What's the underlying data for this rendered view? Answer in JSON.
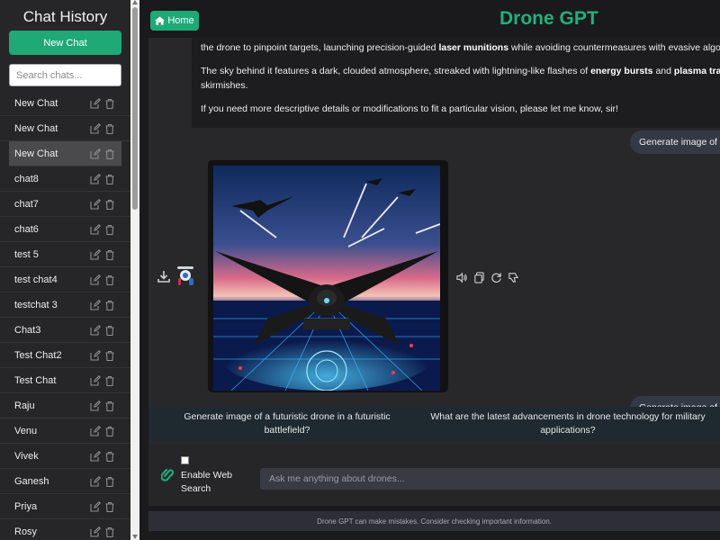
{
  "sidebar": {
    "title": "Chat History",
    "new_chat_label": "New Chat",
    "search_placeholder": "Search chats...",
    "items": [
      {
        "label": "New Chat",
        "active": false
      },
      {
        "label": "New Chat",
        "active": false
      },
      {
        "label": "New Chat",
        "active": true
      },
      {
        "label": "chat8",
        "active": false
      },
      {
        "label": "chat7",
        "active": false
      },
      {
        "label": "chat6",
        "active": false
      },
      {
        "label": "test 5",
        "active": false
      },
      {
        "label": "test chat4",
        "active": false
      },
      {
        "label": "testchat 3",
        "active": false
      },
      {
        "label": "Chat3",
        "active": false
      },
      {
        "label": "Test Chat2",
        "active": false
      },
      {
        "label": "Test Chat",
        "active": false
      },
      {
        "label": "Raju",
        "active": false
      },
      {
        "label": "Venu",
        "active": false
      },
      {
        "label": "Vivek",
        "active": false
      },
      {
        "label": "Ganesh",
        "active": false
      },
      {
        "label": "Priya",
        "active": false
      },
      {
        "label": "Rosy",
        "active": false
      }
    ]
  },
  "header": {
    "home_label": "Home",
    "title": "Drone GPT"
  },
  "chat": {
    "bot_paragraphs": [
      {
        "parts": [
          {
            "t": "the drone to pinpoint targets, launching precision-guided ",
            "b": false
          },
          {
            "t": "laser munitions",
            "b": true
          },
          {
            "t": " while avoiding countermeasures with evasive algorithms",
            "b": false
          }
        ]
      },
      {
        "parts": [
          {
            "t": "The sky behind it features a dark, clouded atmosphere, streaked with lightning-like flashes of ",
            "b": false
          },
          {
            "t": "energy bursts",
            "b": true
          },
          {
            "t": " and ",
            "b": false
          },
          {
            "t": "plasma trails",
            "b": true
          },
          {
            "t": ", re",
            "b": false
          }
        ]
      },
      {
        "parts": [
          {
            "t": "skirmishes.",
            "b": false
          }
        ]
      },
      {
        "parts": [
          {
            "t": "If you need more descriptive details or modifications to fit a particular vision, please let me know, sir!",
            "b": false
          }
        ]
      }
    ],
    "user_message_1": "Generate image of a",
    "user_message_2": "Generate image of a"
  },
  "suggestions": [
    "Generate image of a futuristic drone in a futuristic battlefield?",
    "What are the latest advancements in drone technology for military applications?"
  ],
  "input": {
    "web_search_label": "Enable Web Search",
    "placeholder": "Ask me anything about drones..."
  },
  "footer": {
    "disclaimer": "Drone GPT can make mistakes. Consider checking important information."
  },
  "colors": {
    "accent": "#1ea977",
    "title": "#22b07b"
  },
  "icons": [
    "edit-icon",
    "trash-icon",
    "home-icon",
    "download-icon",
    "speaker-icon",
    "copy-icon",
    "refresh-icon",
    "thumbs-down-icon",
    "paperclip-icon"
  ]
}
